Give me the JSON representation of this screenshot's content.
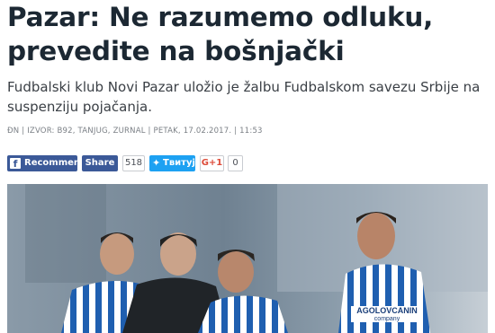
{
  "article": {
    "title_line1": "Pazar: Ne razumemo odluku,",
    "title_line2": "prevedite na bošnjački",
    "lead": "Fudbalski klub Novi Pazar uložio je žalbu Fudbalskom savezu Srbije na suspenziju pojačanja.",
    "meta": "ĐN | IZVOR: B92, TANJUG, ZURNAL | PETAK, 17.02.2017. | 11:53"
  },
  "social": {
    "facebook_label": "Recommend",
    "share_label": "Share",
    "share_count": "518",
    "twitter_label": "Tвитуј",
    "gplus_label": "G+1",
    "gplus_count": "0"
  },
  "photo": {
    "sponsor_text": "AGOLOVCANIN",
    "sponsor_sub": "company"
  },
  "colors": {
    "facebook": "#3b5998",
    "twitter": "#1da1f2",
    "gplus": "#dd4b39"
  }
}
